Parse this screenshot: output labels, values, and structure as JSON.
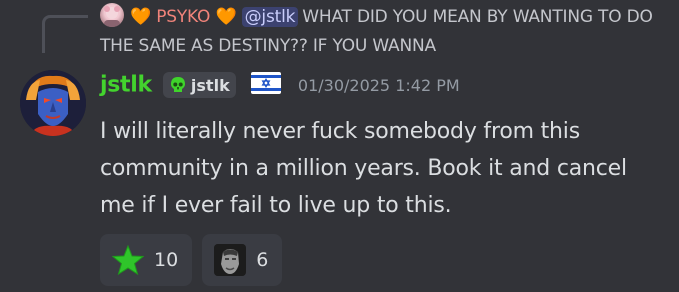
{
  "reply": {
    "username": "PSYKO",
    "heart_before": "🧡",
    "heart_after": "🧡",
    "mention": "@jstlk",
    "text": "WHAT DID YOU MEAN BY WANTING TO DO THE SAME AS DESTINY?? IF YOU WANNA"
  },
  "message": {
    "username": "jstlk",
    "tag": "jstlk",
    "timestamp": "01/30/2025 1:42 PM",
    "content": "I will literally never fuck somebody from this community in a million years. Book it and cancel me if I ever fail to live up to this."
  },
  "reactions": [
    {
      "emoji": "green-star",
      "count": "10"
    },
    {
      "emoji": "chad-face",
      "count": "6"
    }
  ],
  "colors": {
    "background": "#323338",
    "username": "#43d32e",
    "reply_name": "#f0837a",
    "mention_bg": "#3c4270",
    "timestamp": "#949ba4"
  }
}
